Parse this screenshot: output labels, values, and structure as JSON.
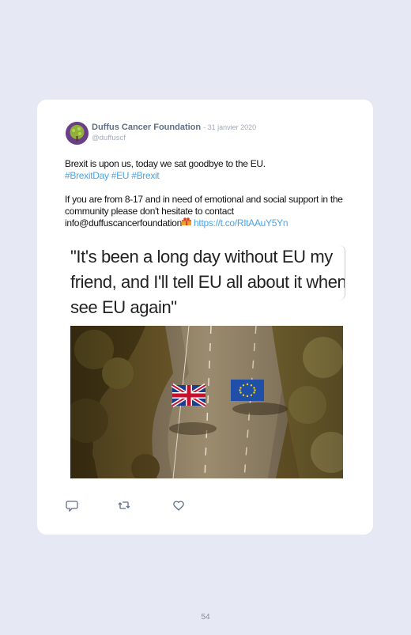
{
  "tweet": {
    "author": "Duffus Cancer Foundation",
    "date": "- 31 janvier 2020",
    "handle": "@duffuscf",
    "line1": "Brexit is upon us, today we sat goodbye to the EU.",
    "hashtags": "#BrexitDay #EU #Brexit",
    "body": "If you are from 8-17 and in need of emotional and social support in the community please don't hesitate to contact info@duffuscancerfoundation",
    "link": "https://t.co/RItAAuY5Yn"
  },
  "meme": {
    "caption": "\"It's been a long day without EU my friend, and I'll tell EU all about it when I see EU again\""
  },
  "actions": {
    "reply_icon": "reply-icon",
    "retweet_icon": "retweet-icon",
    "like_icon": "heart-icon"
  },
  "footer": {
    "page_number": "54"
  }
}
